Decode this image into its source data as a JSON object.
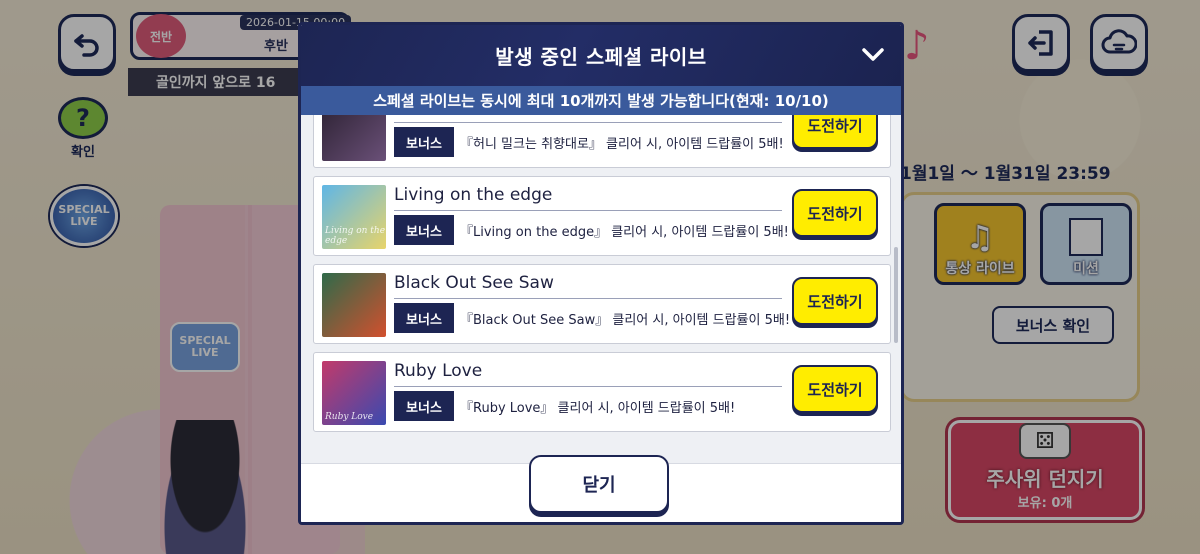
{
  "background": {
    "back_icon": "back-arrow-icon",
    "exit_icon": "exit-icon",
    "cloud_icon": "cloud-sync-icon",
    "first_half_label": "전반",
    "date_text": "2026-01-15 00:00",
    "second_half_label": "후반",
    "goal_text": "골인까지 앞으로 16",
    "question_label": "확인",
    "special_live_label": "SPECIAL LIVE",
    "period_text": "1월1일 ～ 1월31일 23:59",
    "normal_live_label": "통상 라이브",
    "mission_label": "미션",
    "bonus_check_label": "보너스 확인",
    "roll_dice_label": "주사위 던지기",
    "owned_text": "보유: 0개"
  },
  "modal": {
    "title": "발생 중인 스페셜 라이브",
    "subtitle": "스페셜 라이브는 동시에 최대 10개까지 발생 가능합니다(현재: 10/10)",
    "collapse_icon": "chevron-down-icon",
    "close_label": "닫기",
    "lives": [
      {
        "title": "",
        "jacket_text": "",
        "jacket_colors": [
          "#2a2030",
          "#6a5078"
        ],
        "bonus_tag": "보너스",
        "bonus_desc": "『허니 밀크는 취향대로』 클리어 시, 아이템 드랍률이 5배!",
        "button_label": "도전하기"
      },
      {
        "title": "Living on the edge",
        "jacket_text": "Living on the edge",
        "jacket_colors": [
          "#5fb6e6",
          "#e8d46a"
        ],
        "bonus_tag": "보너스",
        "bonus_desc": "『Living on the edge』 클리어 시, 아이템 드랍률이 5배!",
        "button_label": "도전하기"
      },
      {
        "title": "Black Out See Saw",
        "jacket_text": "",
        "jacket_colors": [
          "#2f6a4a",
          "#d2502e"
        ],
        "bonus_tag": "보너스",
        "bonus_desc": "『Black Out See Saw』 클리어 시, 아이템 드랍률이 5배!",
        "button_label": "도전하기"
      },
      {
        "title": "Ruby Love",
        "jacket_text": "Ruby Love",
        "jacket_colors": [
          "#c23a6a",
          "#3a4ab0"
        ],
        "bonus_tag": "보너스",
        "bonus_desc": "『Ruby Love』 클리어 시, 아이템 드랍률이 5배!",
        "button_label": "도전하기"
      }
    ]
  },
  "colors": {
    "navy": "#1d2553",
    "subheader_blue": "#3a5a9c",
    "challenge_yellow": "#ffed00",
    "dice_red": "#d94866"
  }
}
